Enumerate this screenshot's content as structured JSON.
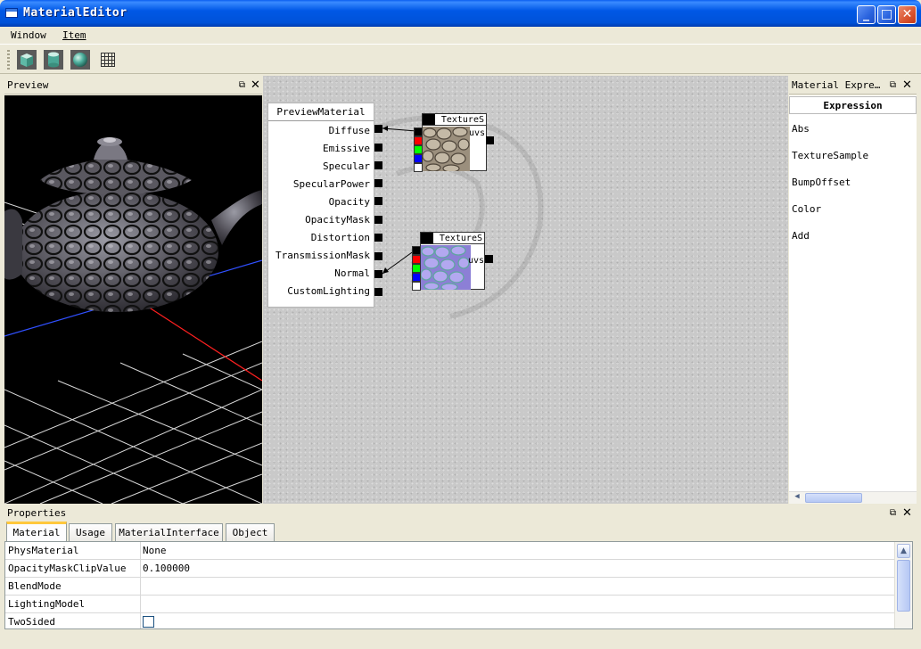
{
  "window": {
    "title": "MaterialEditor"
  },
  "menu": [
    {
      "label": "Window"
    },
    {
      "label": "Item"
    }
  ],
  "toolbar": {
    "buttons": [
      {
        "icon": "cube-preview-icon",
        "name": "Cube"
      },
      {
        "icon": "cylinder-preview-icon",
        "name": "Cylinder"
      },
      {
        "icon": "sphere-preview-icon",
        "name": "Sphere"
      },
      {
        "icon": "grid-icon",
        "name": "Grid"
      }
    ]
  },
  "preview": {
    "title": "Preview"
  },
  "canvas": {
    "material_node": {
      "title": "PreviewMaterial",
      "pins": [
        "Diffuse",
        "Emissive",
        "Specular",
        "SpecularPower",
        "Opacity",
        "OpacityMask",
        "Distortion",
        "TransmissionMask",
        "Normal",
        "CustomLighting"
      ]
    },
    "texture_nodes": [
      {
        "title": "TextureS",
        "output_label": "uvs"
      },
      {
        "title": "TextureS",
        "output_label": "uvs"
      }
    ]
  },
  "expressions": {
    "panel_title": "Material Expre…",
    "header": "Expression",
    "items": [
      "Abs",
      "TextureSample",
      "BumpOffset",
      "Color",
      "Add"
    ]
  },
  "properties": {
    "title": "Properties",
    "tabs": [
      "Material",
      "Usage",
      "MaterialInterface",
      "Object"
    ],
    "active_tab": "Material",
    "rows": [
      {
        "name": "PhysMaterial",
        "value": "None"
      },
      {
        "name": "OpacityMaskClipValue",
        "value": "0.100000"
      },
      {
        "name": "BlendMode",
        "value": ""
      },
      {
        "name": "LightingModel",
        "value": ""
      },
      {
        "name": "TwoSided",
        "value": ""
      }
    ]
  },
  "colors": {
    "titlebar": "#0055e5",
    "chrome": "#ece9d8",
    "active_tab_accent": "#ffc83c",
    "pin_red": "#ff0000",
    "pin_green": "#00ff00",
    "pin_blue": "#0000ff"
  }
}
